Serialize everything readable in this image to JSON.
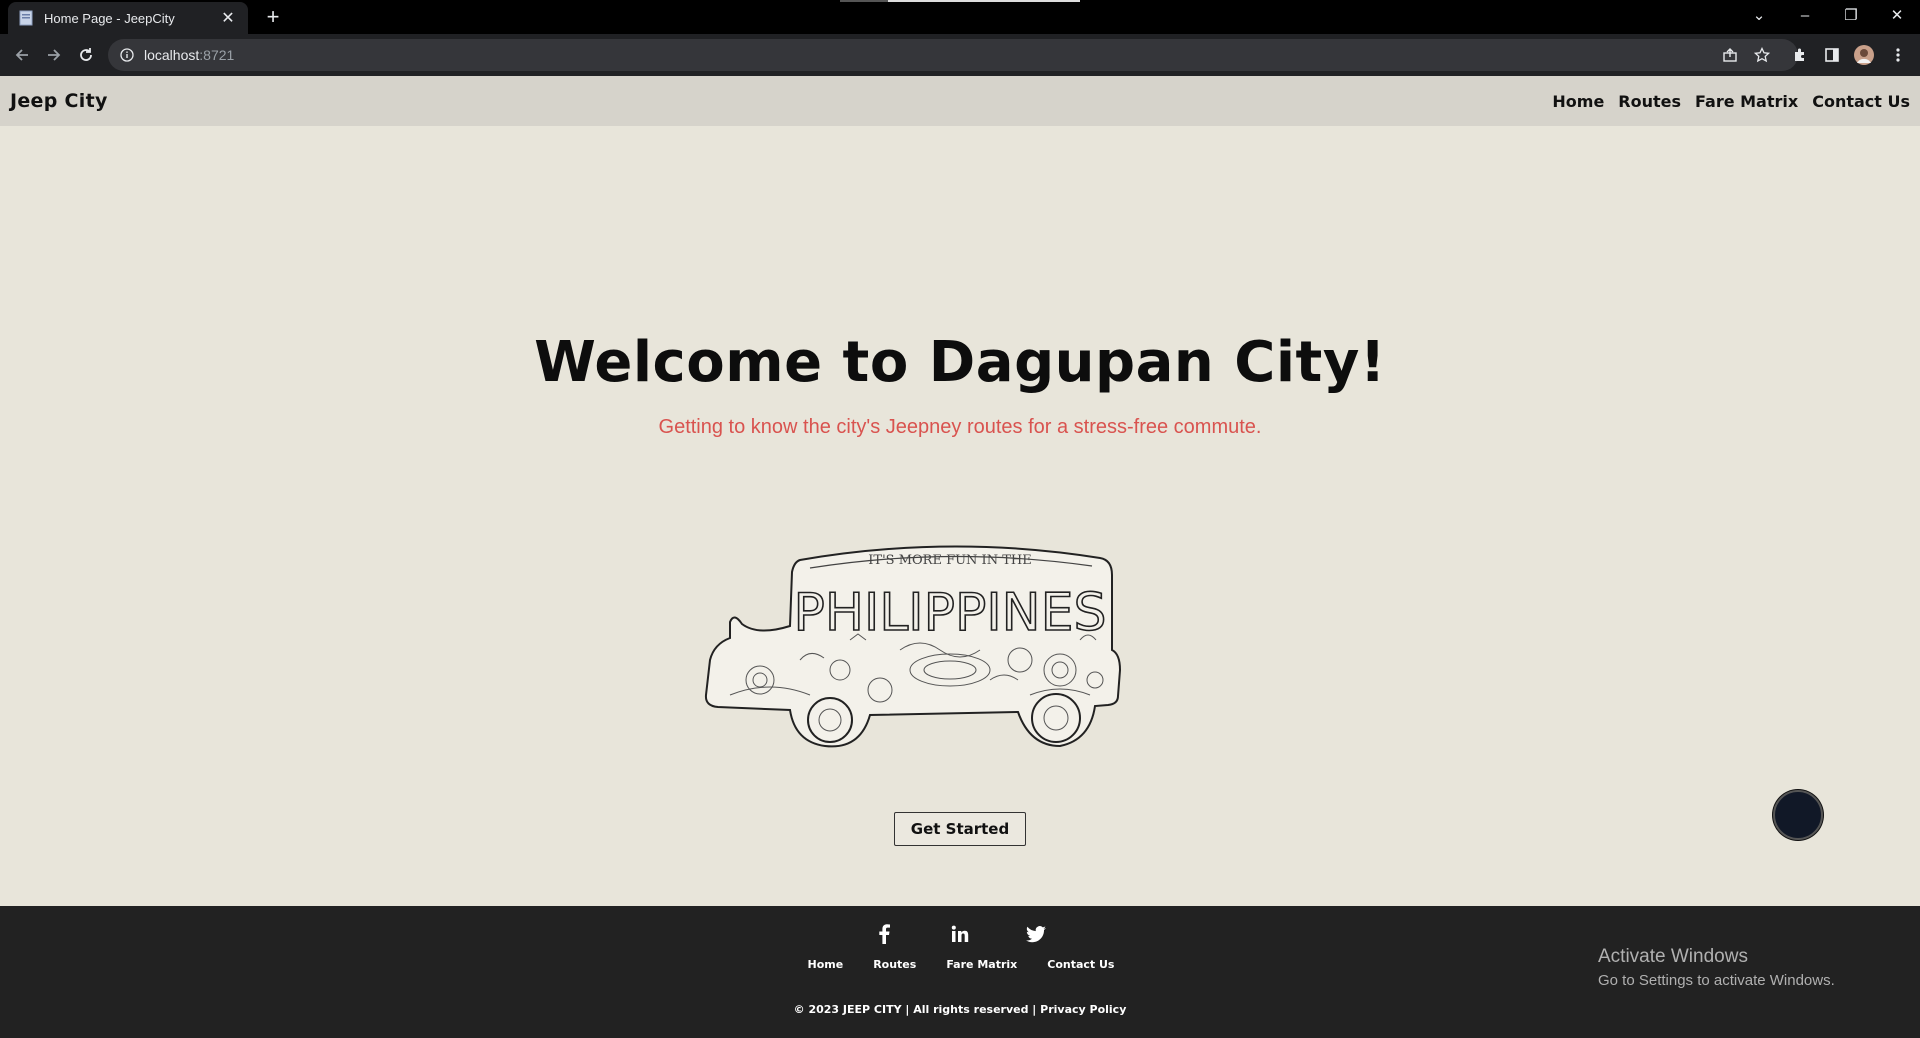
{
  "browser": {
    "tab_title": "Home Page - JeepCity",
    "url_host": "localhost",
    "url_port": ":8721"
  },
  "site": {
    "brand": "Jeep City",
    "nav": [
      "Home",
      "Routes",
      "Fare Matrix",
      "Contact Us"
    ]
  },
  "hero": {
    "title": "Welcome to Dagupan City!",
    "subtitle": "Getting to know the city's Jeepney routes for a stress-free commute.",
    "jeep_banner_text": "PHILIPPINES",
    "jeep_top_text": "IT'S MORE FUN IN THE",
    "cta": "Get Started"
  },
  "footer": {
    "social": [
      "facebook-icon",
      "linkedin-icon",
      "twitter-icon"
    ],
    "links": [
      "Home",
      "Routes",
      "Fare Matrix",
      "Contact Us"
    ],
    "copyright": "© 2023 JEEP CITY | All rights reserved | Privacy Policy"
  },
  "os_watermark": {
    "title": "Activate Windows",
    "subtitle": "Go to Settings to activate Windows."
  },
  "colors": {
    "page_bg": "#e8e5da",
    "nav_bg": "#d6d3cb",
    "footer_bg": "#222222",
    "subtitle": "#d9534f"
  }
}
